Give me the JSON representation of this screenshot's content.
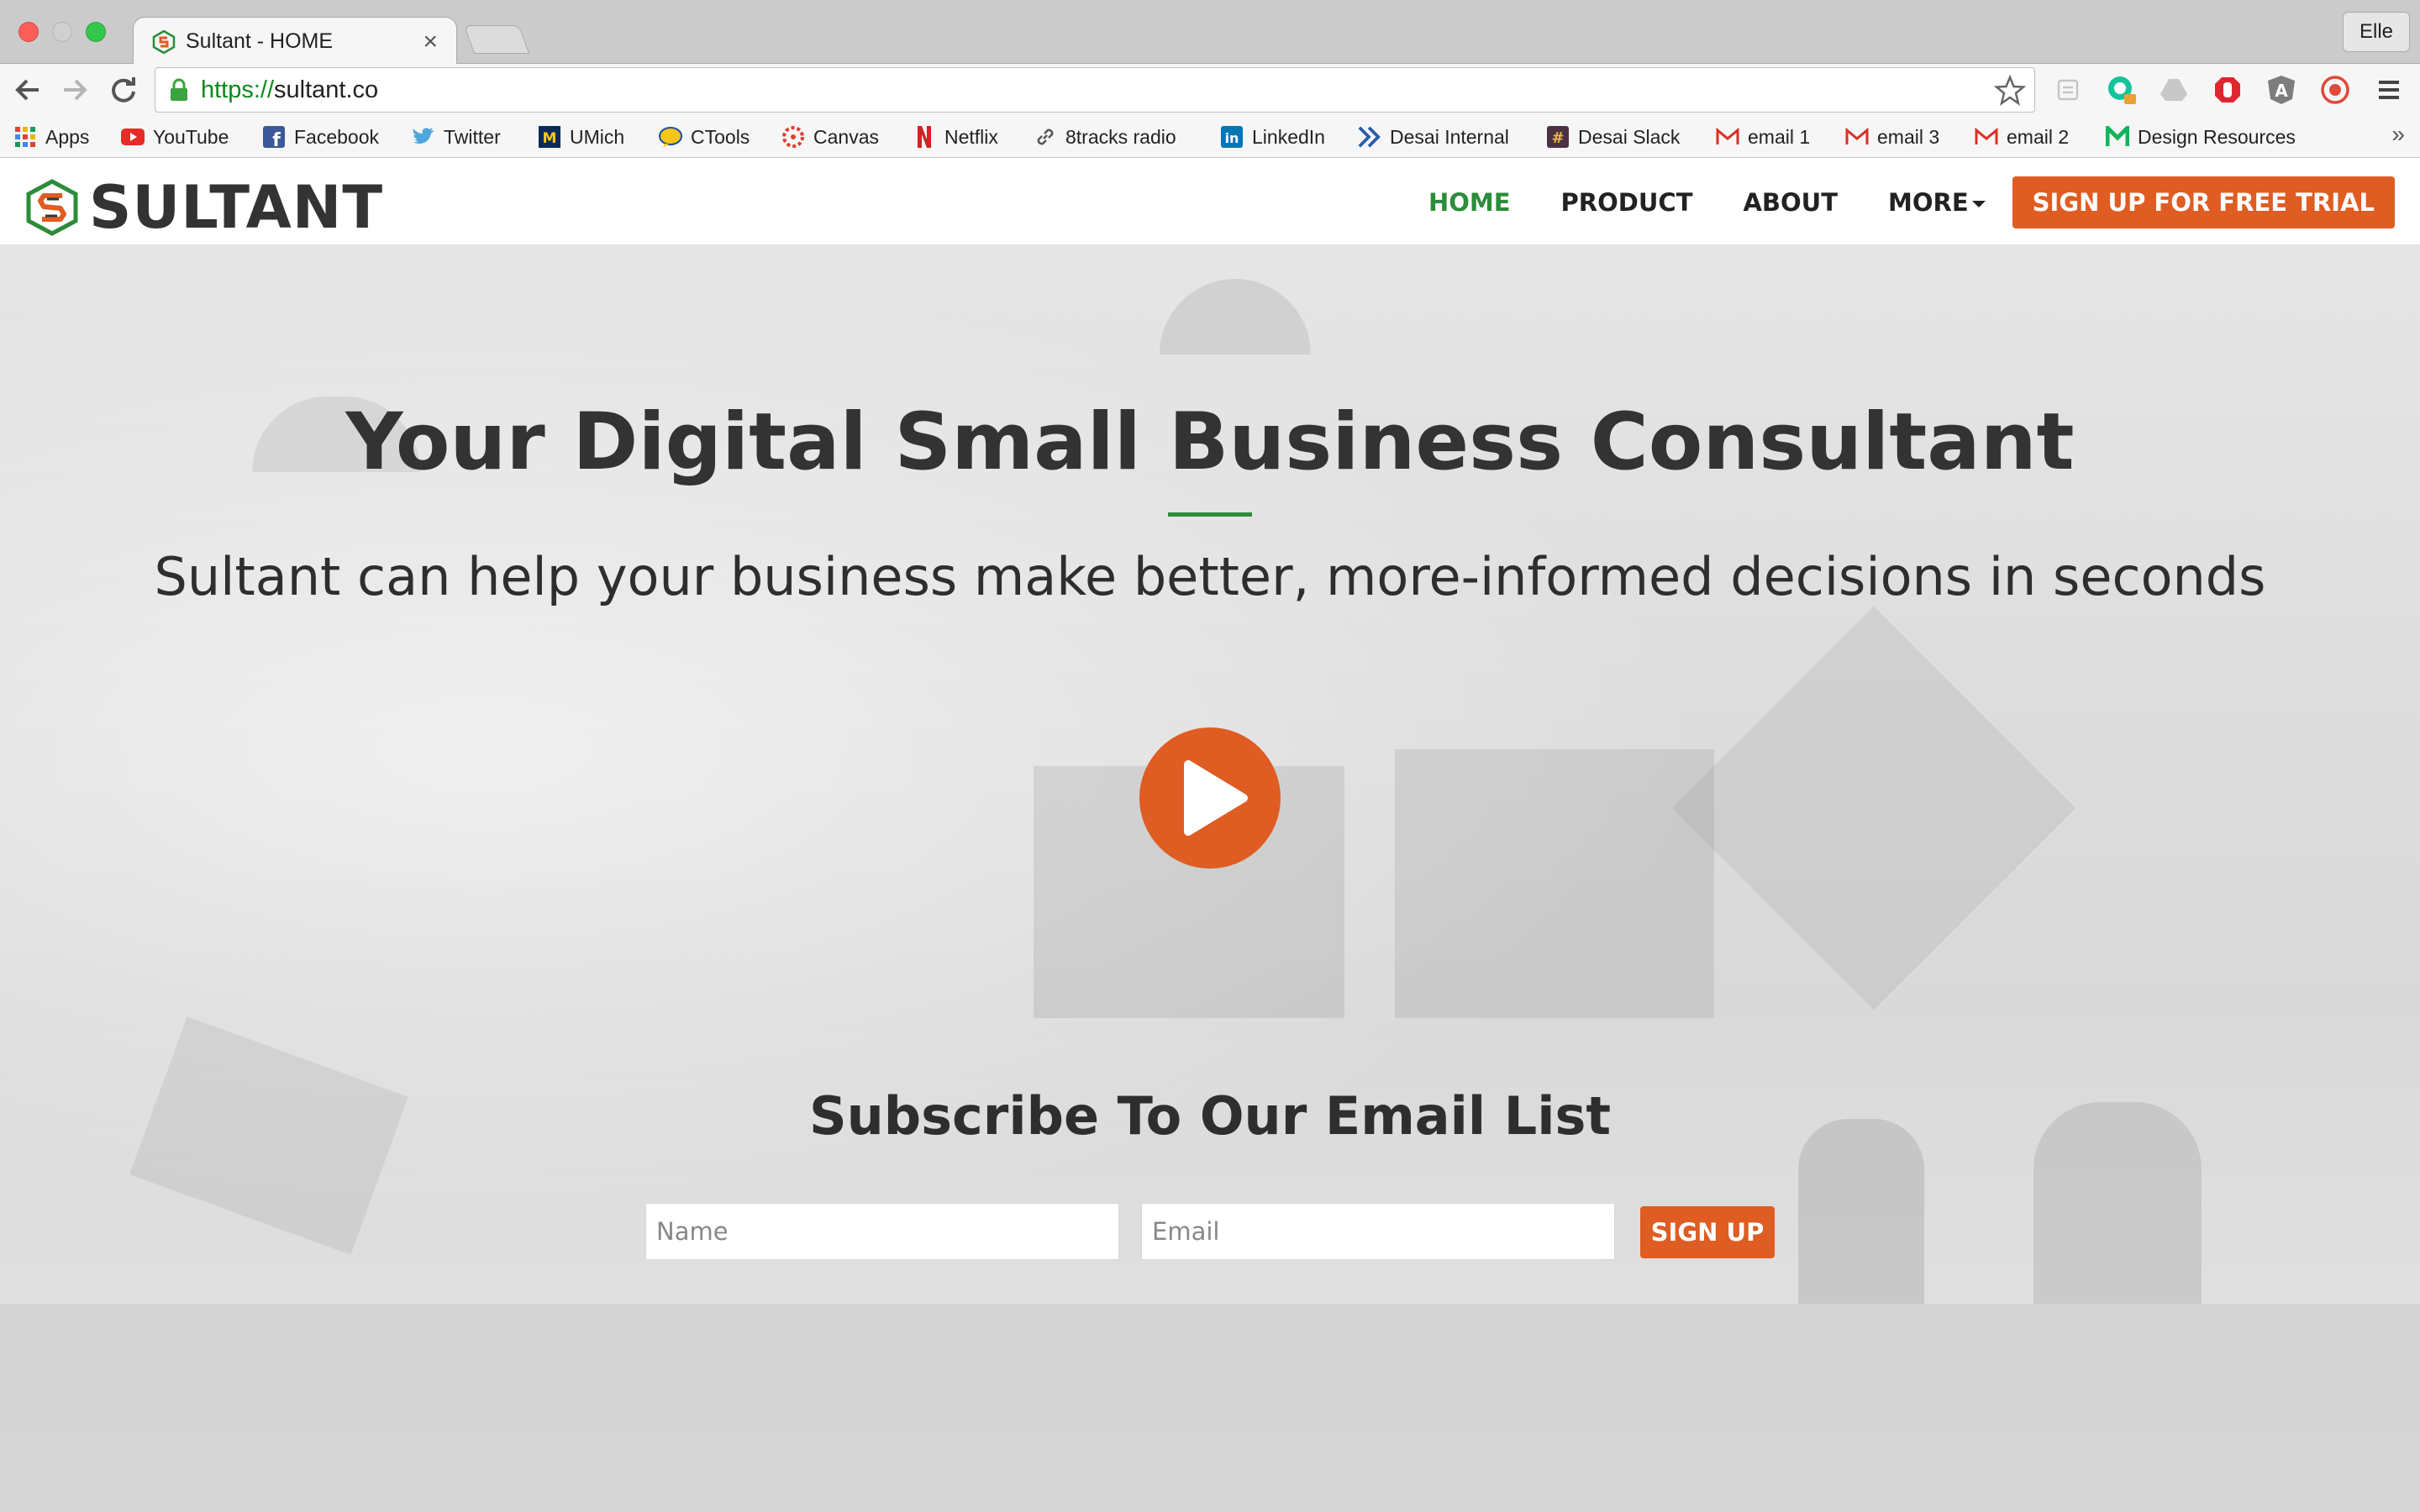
{
  "browser": {
    "tab_title": "Sultant - HOME",
    "tab_close": "×",
    "profile_name": "Elle",
    "url_scheme": "https://",
    "url_host": "sultant.co"
  },
  "bookmarks": [
    {
      "label": "Apps",
      "icon": "apps-grid-icon"
    },
    {
      "label": "YouTube",
      "icon": "youtube-icon"
    },
    {
      "label": "Facebook",
      "icon": "facebook-icon"
    },
    {
      "label": "Twitter",
      "icon": "twitter-icon"
    },
    {
      "label": "UMich",
      "icon": "umich-icon"
    },
    {
      "label": "CTools",
      "icon": "ctools-icon"
    },
    {
      "label": "Canvas",
      "icon": "canvas-icon"
    },
    {
      "label": "Netflix",
      "icon": "netflix-icon"
    },
    {
      "label": "8tracks radio",
      "icon": "link-icon"
    },
    {
      "label": "LinkedIn",
      "icon": "linkedin-icon"
    },
    {
      "label": "Desai Internal",
      "icon": "desai-icon"
    },
    {
      "label": "Desai Slack",
      "icon": "slack-icon"
    },
    {
      "label": "email 1",
      "icon": "gmail-icon"
    },
    {
      "label": "email 3",
      "icon": "gmail-icon"
    },
    {
      "label": "email 2",
      "icon": "gmail-icon"
    },
    {
      "label": "Design Resources",
      "icon": "design-resources-icon"
    }
  ],
  "bookmarks_overflow": "»",
  "site": {
    "logo_text": "SULTANT",
    "nav": {
      "home": "HOME",
      "product": "PRODUCT",
      "about": "ABOUT",
      "more": "MORE",
      "cta": "SIGN UP FOR FREE TRIAL"
    },
    "colors": {
      "accent_orange": "#df5c22",
      "accent_green": "#2c8c3a"
    }
  },
  "hero": {
    "title": "Your Digital Small Business Consultant",
    "subtitle": "Sultant can help your business make better, more-informed decisions in seconds",
    "play_icon": "play-icon"
  },
  "subscribe": {
    "title": "Subscribe To Our Email List",
    "name_placeholder": "Name",
    "email_placeholder": "Email",
    "button": "SIGN UP"
  }
}
